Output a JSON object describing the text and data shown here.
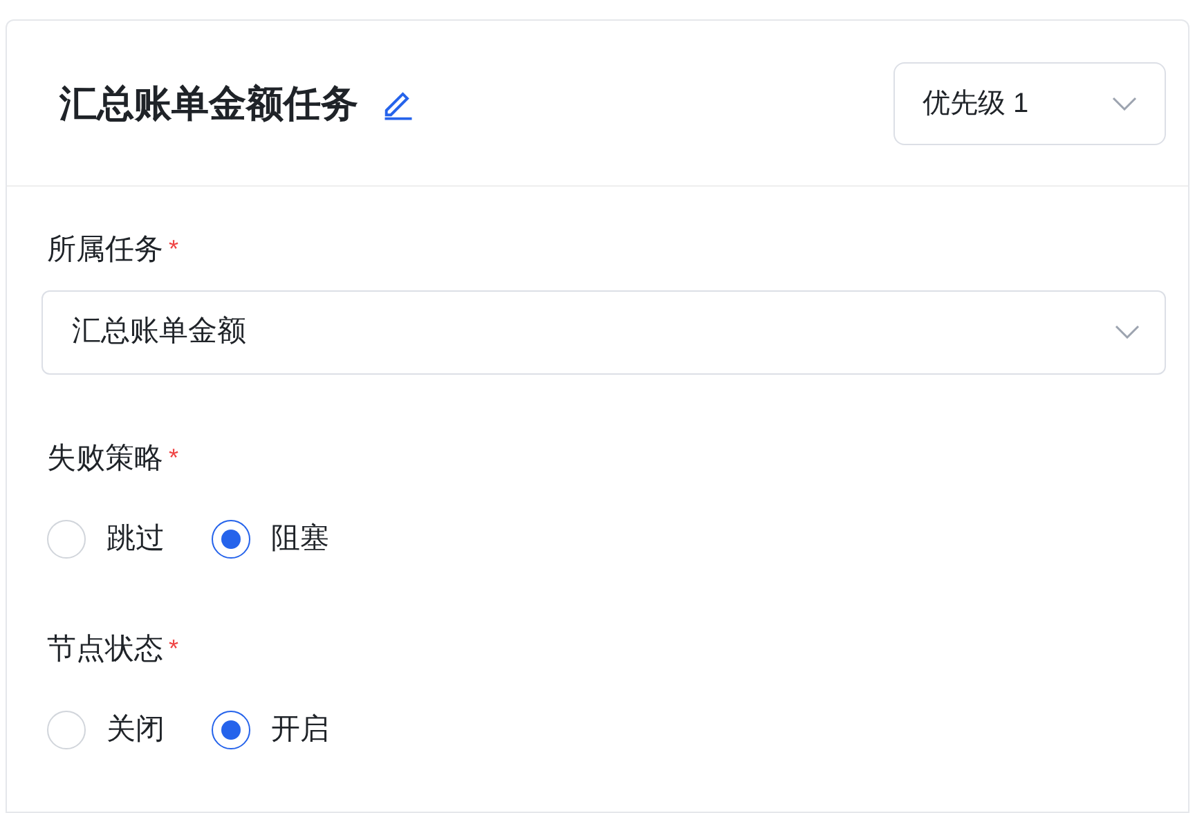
{
  "header": {
    "title": "汇总账单金额任务",
    "priority": "优先级 1"
  },
  "fields": [
    {
      "kind": "select",
      "label": "所属任务",
      "required_mark": "*",
      "value": "汇总账单金额"
    },
    {
      "kind": "radio",
      "label": "失败策略",
      "required_mark": "*",
      "options": [
        {
          "label": "跳过",
          "selected": false
        },
        {
          "label": "阻塞",
          "selected": true
        }
      ]
    },
    {
      "kind": "radio",
      "label": "节点状态",
      "required_mark": "*",
      "options": [
        {
          "label": "关闭",
          "selected": false
        },
        {
          "label": "开启",
          "selected": true
        }
      ]
    }
  ]
}
